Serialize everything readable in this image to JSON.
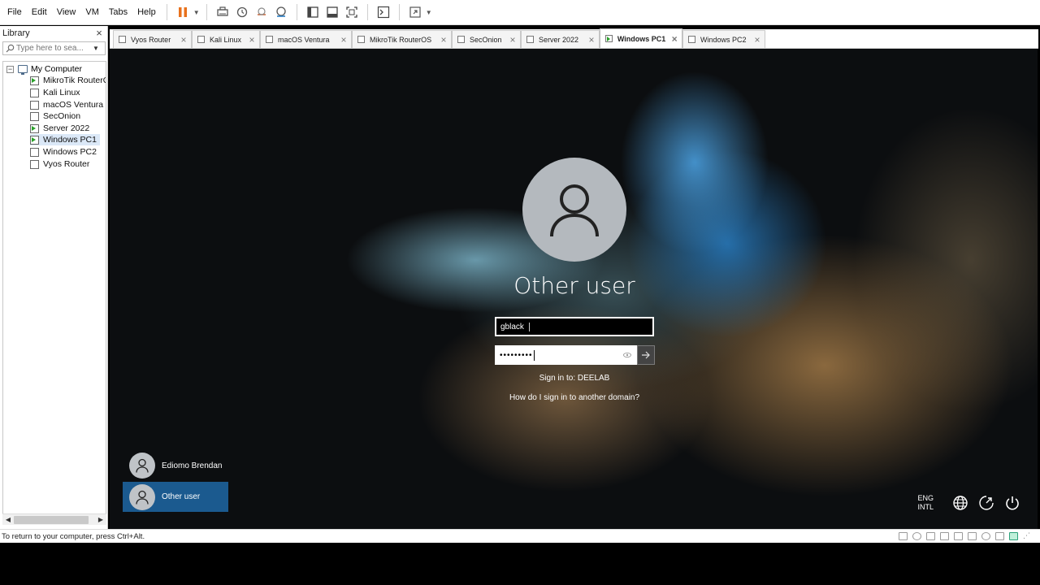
{
  "menu": {
    "items": [
      "File",
      "Edit",
      "View",
      "VM",
      "Tabs",
      "Help"
    ]
  },
  "library": {
    "title": "Library",
    "search_placeholder": "Type here to sea...",
    "root_label": "My Computer",
    "items": [
      {
        "label": "MikroTik RouterOS",
        "running": true
      },
      {
        "label": "Kali Linux",
        "running": false
      },
      {
        "label": "macOS Ventura",
        "running": false
      },
      {
        "label": "SecOnion",
        "running": false
      },
      {
        "label": "Server 2022",
        "running": true
      },
      {
        "label": "Windows PC1",
        "running": true
      },
      {
        "label": "Windows PC2",
        "running": false
      },
      {
        "label": "Vyos Router",
        "running": false
      }
    ]
  },
  "tabs": [
    {
      "label": "Vyos Router"
    },
    {
      "label": "Kali Linux"
    },
    {
      "label": "macOS Ventura"
    },
    {
      "label": "MikroTik RouterOS"
    },
    {
      "label": "SecOnion"
    },
    {
      "label": "Server 2022"
    },
    {
      "label": "Windows PC1",
      "active": true
    },
    {
      "label": "Windows PC2"
    }
  ],
  "login": {
    "name": "Other user",
    "username_value": "gblack",
    "password_masked": "•••••••••",
    "signin_to": "Sign in to: DEELAB",
    "other_domain_link": "How do I sign in to another domain?"
  },
  "users": [
    {
      "name": "Ediomo Brendan",
      "selected": false
    },
    {
      "name": "Other user",
      "selected": true
    }
  ],
  "tray": {
    "lang_top": "ENG",
    "lang_bottom": "INTL",
    "icons": [
      "network-icon",
      "accessibility-icon",
      "power-icon"
    ]
  },
  "status": {
    "text": "To return to your computer, press Ctrl+Alt."
  },
  "colors": {
    "pause_accent": "#e8711c",
    "selected_user_tile": "#1b5a8f",
    "running_vm": "#2aa12a"
  }
}
